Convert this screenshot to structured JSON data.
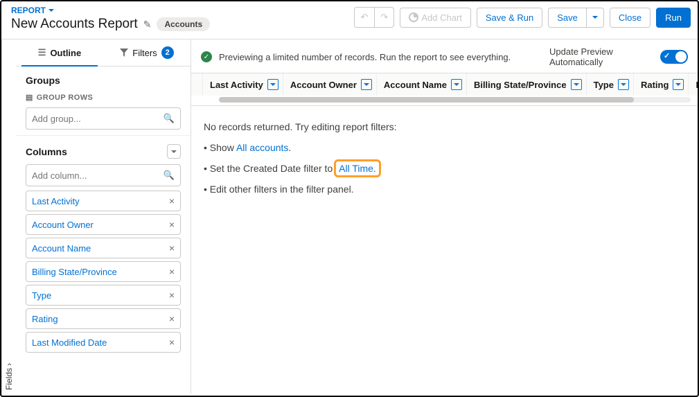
{
  "header": {
    "report_label": "REPORT",
    "title": "New Accounts Report",
    "object_badge": "Accounts",
    "buttons": {
      "add_chart": "Add Chart",
      "save_run": "Save & Run",
      "save": "Save",
      "close": "Close",
      "run": "Run"
    }
  },
  "fields_tab": "Fields",
  "sidebar": {
    "tabs": {
      "outline": "Outline",
      "filters": "Filters",
      "filter_count": "2"
    },
    "groups": {
      "title": "Groups",
      "sub": "GROUP ROWS",
      "placeholder": "Add group..."
    },
    "columns": {
      "title": "Columns",
      "placeholder": "Add column...",
      "items": [
        "Last Activity",
        "Account Owner",
        "Account Name",
        "Billing State/Province",
        "Type",
        "Rating",
        "Last Modified Date"
      ]
    }
  },
  "preview": {
    "message": "Previewing a limited number of records. Run the report to see everything.",
    "update_label": "Update Preview Automatically"
  },
  "table": {
    "columns": [
      "Last Activity",
      "Account Owner",
      "Account Name",
      "Billing State/Province",
      "Type",
      "Rating",
      "Las"
    ]
  },
  "empty": {
    "heading": "No records returned. Try editing report filters:",
    "b1_pre": "Show ",
    "b1_link": "All accounts",
    "b1_post": ".",
    "b2_pre": "Set the Created Date filter to ",
    "b2_link": "All Time",
    "b2_post": ".",
    "b3": "Edit other filters in the filter panel."
  }
}
